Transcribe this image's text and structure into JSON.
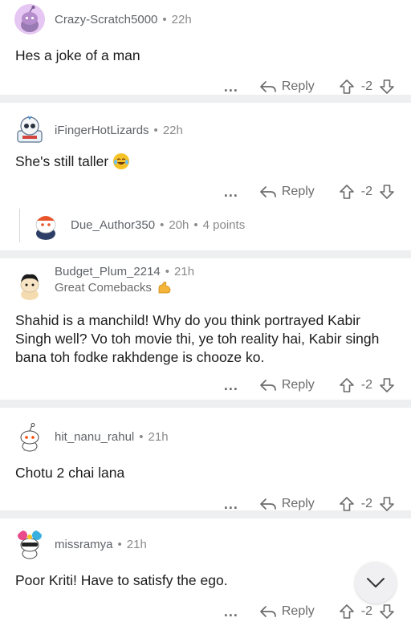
{
  "comments": [
    {
      "username": "Crazy-Scratch5000",
      "time": "22h",
      "text": "Hes a joke of a man",
      "more_label": "...",
      "reply_label": "Reply",
      "score": "-2"
    },
    {
      "username": "iFingerHotLizards",
      "time": "22h",
      "text": "She's still taller",
      "emoji": "laughing-tears-emoji",
      "more_label": "...",
      "reply_label": "Reply",
      "score": "-2"
    },
    {
      "username": "Due_Author350",
      "time": "20h",
      "points": "4 points",
      "collapsed": true
    },
    {
      "username": "Budget_Plum_2214",
      "time": "21h",
      "flair": "Great Comebacks",
      "flair_icon": "flexed-biceps-emoji",
      "text": "Shahid is a manchild! Why do you think portrayed Kabir Singh well? Vo toh movie thi, ye toh reality hai, Kabir singh bana toh fodke rakhdenge is chooze ko.",
      "more_label": "...",
      "reply_label": "Reply",
      "score": "-2"
    },
    {
      "username": "hit_nanu_rahul",
      "time": "21h",
      "text": "Chotu 2 chai lana",
      "more_label": "...",
      "reply_label": "Reply",
      "score": "-2"
    },
    {
      "username": "missramya",
      "time": "21h",
      "text": "Poor Kriti! Have to satisfy the ego.",
      "more_label": "...",
      "reply_label": "Reply",
      "score": "-2"
    }
  ],
  "separator": "•",
  "icons": {
    "reply": "reply-arrow-icon",
    "upvote": "upvote-arrow-icon",
    "downvote": "downvote-arrow-icon",
    "collapse": "chevron-down-icon"
  },
  "colors": {
    "text": "#1c1c1c",
    "muted": "#6b6b6b",
    "divider": "#eeeff1"
  }
}
